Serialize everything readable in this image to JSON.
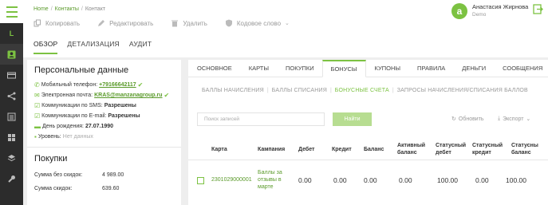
{
  "header": {
    "breadcrumb": [
      "Home",
      "Контакты",
      "Контакт"
    ],
    "toolbar": {
      "copy": "Копировать",
      "edit": "Редактировать",
      "delete": "Удалить",
      "codeword": "Кодовое слово"
    },
    "tabs": [
      "ОБЗОР",
      "ДЕТАЛИЗАЦИЯ",
      "АУДИТ"
    ],
    "active_tab": "ОБЗОР"
  },
  "user": {
    "initial": "a",
    "name": "Анастасия Жирнова",
    "role": "Demo"
  },
  "sidenav": {
    "items": [
      "L",
      "contact-icon",
      "card-icon",
      "share-icon",
      "list-icon",
      "grid-icon",
      "layers-icon",
      "wrench-icon"
    ]
  },
  "personal": {
    "title": "Персональные данные",
    "phone_label": "Мобильный телефон:",
    "phone": "+79166642117",
    "email_label": "Электронная почта:",
    "email": "KRAS@manzanagroup.ru",
    "sms_label": "Коммуникации по SMS:",
    "sms": "Разрешены",
    "emailcomm_label": "Коммуникации по E-mail:",
    "emailcomm": "Разрешены",
    "birthday_label": "День рождения:",
    "birthday": "27.07.1990",
    "level_label": "Уровень:",
    "level": "Нет данных"
  },
  "purchases": {
    "title": "Покупки",
    "sum_no_discount_label": "Сумма без скидок:",
    "sum_no_discount": "4 989.00",
    "sum_discount_label": "Сумма скидок:",
    "sum_discount": "639.60"
  },
  "right": {
    "tabs": [
      "ОСНОВНОЕ",
      "КАРТЫ",
      "ПОКУПКИ",
      "БОНУСЫ",
      "КУПОНЫ",
      "ПРАВИЛА",
      "ДЕНЬГИ",
      "СООБЩЕНИЯ"
    ],
    "active_tab": "БОНУСЫ",
    "subtabs": [
      "БАЛЛЫ НАЧИСЛЕНИЯ",
      "БАЛЛЫ СПИСАНИЯ",
      "БОНУСНЫЕ СЧЕТА",
      "ЗАПРОСЫ НАЧИСЛЕНИЯ/СПИСАНИЯ БАЛЛОВ"
    ],
    "active_subtab": "БОНУСНЫЕ СЧЕТА",
    "search_placeholder": "Поиск записей",
    "find_label": "Найти",
    "refresh_label": "Обновить",
    "export_label": "Экспорт",
    "columns": [
      "Карта",
      "Кампания",
      "Дебет",
      "Кредит",
      "Баланс",
      "Активный баланс",
      "Статусный дебет",
      "Статусный кредит",
      "Статусны баланс"
    ],
    "row": {
      "card": "2301029000001",
      "campaign": "Баллы за отзывы в марте",
      "debit": "0.00",
      "credit": "0.00",
      "balance": "0.00",
      "active_balance": "0.00",
      "status_debit": "100.00",
      "status_credit": "0.00",
      "status_balance": "100.00"
    }
  },
  "colors": {
    "accent": "#7cc242",
    "link": "#5a9a2a",
    "sidebar": "#2c2c2c"
  }
}
